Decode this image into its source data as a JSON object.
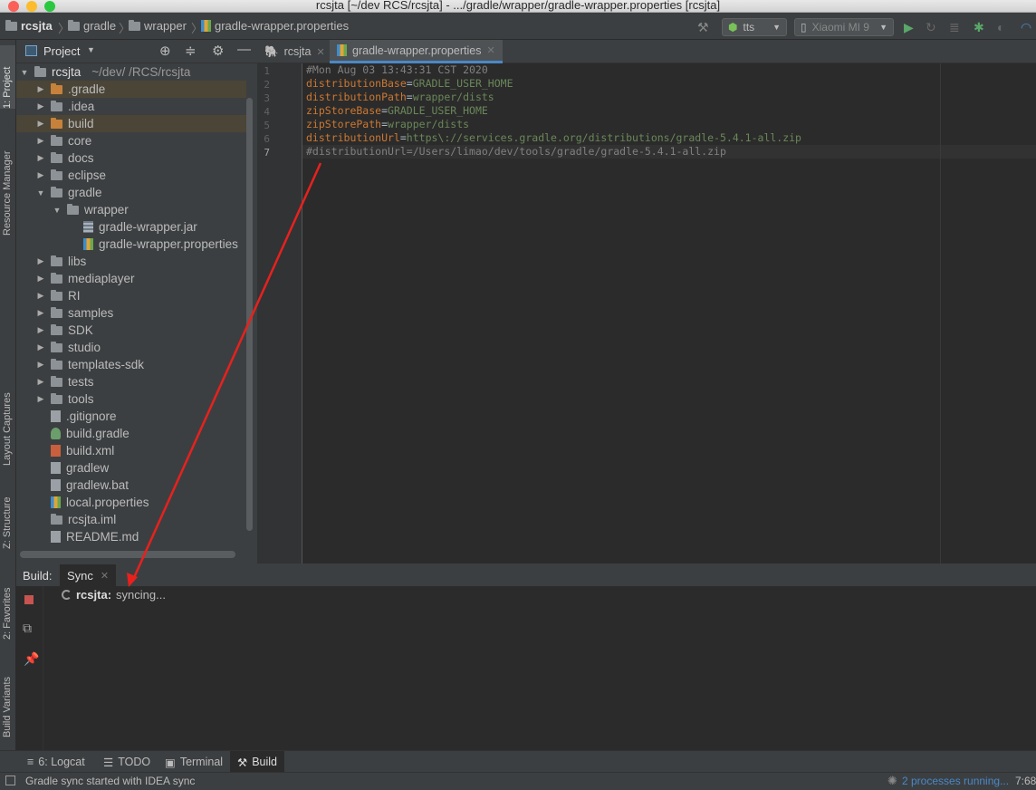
{
  "window": {
    "title": "rcsjta [~/dev        RCS/rcsjta] - .../gradle/wrapper/gradle-wrapper.properties [rcsjta]"
  },
  "breadcrumbs": [
    "rcsjta",
    "gradle",
    "wrapper",
    "gradle-wrapper.properties"
  ],
  "toolbar": {
    "config_label": "tts",
    "device_label": "Xiaomi MI 9"
  },
  "left_strip": {
    "project": "1: Project",
    "resource_manager": "Resource Manager",
    "layout_captures": "Layout Captures",
    "structure": "Z: Structure",
    "favorites": "2: Favorites",
    "build_variants": "Build Variants"
  },
  "project_panel": {
    "header": "Project",
    "root": {
      "name": "rcsjta",
      "path": "~/dev/        /RCS/rcsjta"
    },
    "items": [
      {
        "label": ".gradle",
        "icon": "folder-orange"
      },
      {
        "label": ".idea",
        "icon": "folder"
      },
      {
        "label": "build",
        "icon": "folder-orange"
      },
      {
        "label": "core",
        "icon": "folder"
      },
      {
        "label": "docs",
        "icon": "folder"
      },
      {
        "label": "eclipse",
        "icon": "folder"
      },
      {
        "label": "gradle",
        "icon": "folder"
      },
      {
        "label": "wrapper",
        "icon": "folder"
      },
      {
        "label": "gradle-wrapper.jar",
        "icon": "jar-file"
      },
      {
        "label": "gradle-wrapper.properties",
        "icon": "properties-file"
      },
      {
        "label": "libs",
        "icon": "folder"
      },
      {
        "label": "mediaplayer",
        "icon": "module-folder"
      },
      {
        "label": "RI",
        "icon": "module-folder"
      },
      {
        "label": "samples",
        "icon": "folder"
      },
      {
        "label": "SDK",
        "icon": "module-folder"
      },
      {
        "label": "studio",
        "icon": "folder"
      },
      {
        "label": "templates-sdk",
        "icon": "folder"
      },
      {
        "label": "tests",
        "icon": "folder"
      },
      {
        "label": "tools",
        "icon": "folder"
      },
      {
        "label": ".gitignore",
        "icon": "file"
      },
      {
        "label": "build.gradle",
        "icon": "gradle-file"
      },
      {
        "label": "build.xml",
        "icon": "xml-file"
      },
      {
        "label": "gradlew",
        "icon": "file"
      },
      {
        "label": "gradlew.bat",
        "icon": "file"
      },
      {
        "label": "local.properties",
        "icon": "properties-file"
      },
      {
        "label": "rcsjta.iml",
        "icon": "module-file"
      },
      {
        "label": "README.md",
        "icon": "file"
      }
    ]
  },
  "editor": {
    "tabs": [
      {
        "label": "rcsjta"
      },
      {
        "label": "gradle-wrapper.properties"
      }
    ],
    "line_numbers": [
      "1",
      "2",
      "3",
      "4",
      "5",
      "6",
      "7"
    ],
    "lines": [
      {
        "comment": "#Mon Aug 03 13:43:31 CST 2020"
      },
      {
        "key": "distributionBase",
        "eq": "=",
        "value": "GRADLE_USER_HOME"
      },
      {
        "key": "distributionPath",
        "eq": "=",
        "value": "wrapper/dists"
      },
      {
        "key": "zipStoreBase",
        "eq": "=",
        "value": "GRADLE_USER_HOME"
      },
      {
        "key": "zipStorePath",
        "eq": "=",
        "value": "wrapper/dists"
      },
      {
        "key": "distributionUrl",
        "eq": "=",
        "value": "https\\://services.gradle.org/distributions/gradle-5.4.1-all.zip"
      },
      {
        "comment": "#distributionUrl=/Users/limao/dev/tools/gradle/gradle-5.4.1-all.zip"
      }
    ]
  },
  "build_panel": {
    "label": "Build:",
    "tab": "Sync",
    "project": "rcsjta:",
    "status": "syncing..."
  },
  "bottom_tabs": {
    "logcat": "6: Logcat",
    "todo": "TODO",
    "terminal": "Terminal",
    "build": "Build"
  },
  "status_bar": {
    "message": "Gradle sync started with IDEA sync",
    "processes": "2 processes running...",
    "position": "7:68"
  },
  "colors": {
    "annotation_arrow": "#e8211d",
    "link": "#4a88c7"
  }
}
